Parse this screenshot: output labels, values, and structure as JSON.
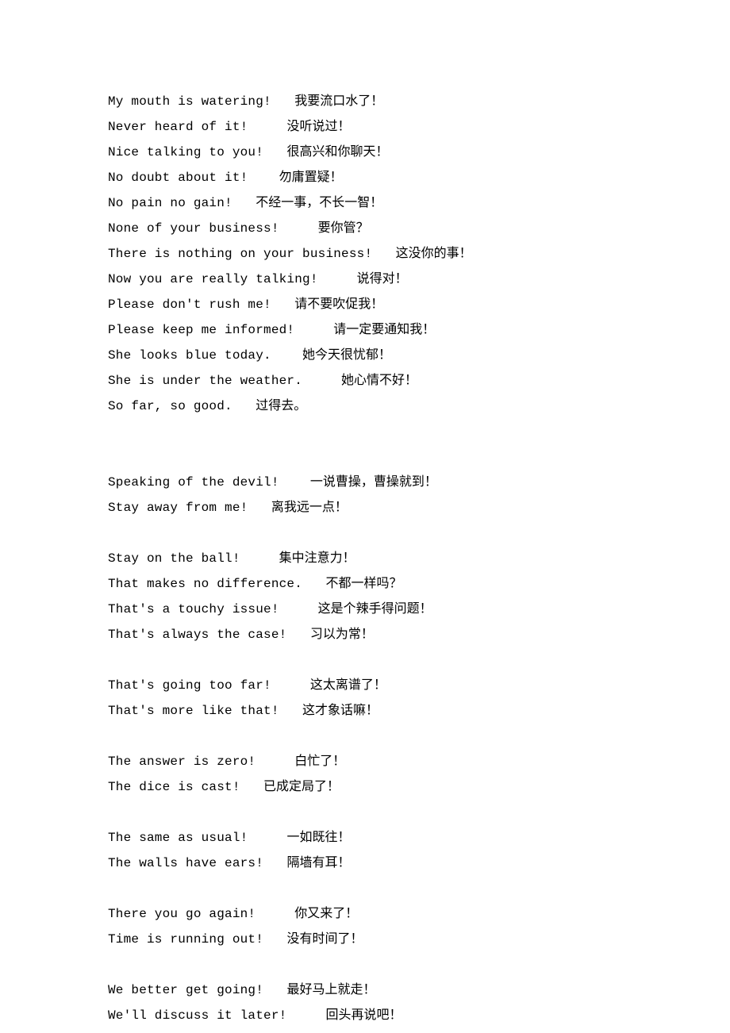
{
  "lines": [
    {
      "en": "My mouth is watering!   ",
      "zh": "我要流口水了！"
    },
    {
      "en": "Never heard of it!     ",
      "zh": "没听说过！"
    },
    {
      "en": "Nice talking to you!   ",
      "zh": "很高兴和你聊天！"
    },
    {
      "en": "No doubt about it!    ",
      "zh": "勿庸置疑！"
    },
    {
      "en": "No pain no gain!   ",
      "zh": "不经一事，不长一智！"
    },
    {
      "en": "None of your business!     ",
      "zh": "要你管？"
    },
    {
      "en": "There is nothing on your business!   ",
      "zh": "这没你的事！"
    },
    {
      "en": "Now you are really talking!     ",
      "zh": "说得对！"
    },
    {
      "en": "Please don't rush me!   ",
      "zh": "请不要吹促我！"
    },
    {
      "en": "Please keep me informed!     ",
      "zh": "请一定要通知我！"
    },
    {
      "en": "She looks blue today.    ",
      "zh": "她今天很忧郁！"
    },
    {
      "en": "She is under the weather.     ",
      "zh": "她心情不好！"
    },
    {
      "en": "So far, so good.   ",
      "zh": "过得去。"
    },
    null,
    null,
    {
      "en": "Speaking of the devil!    ",
      "zh": "一说曹操，曹操就到！"
    },
    {
      "en": "Stay away from me!   ",
      "zh": "离我远一点！"
    },
    null,
    {
      "en": "Stay on the ball!     ",
      "zh": "集中注意力！"
    },
    {
      "en": "That makes no difference.   ",
      "zh": "不都一样吗？"
    },
    {
      "en": "That's a touchy issue!     ",
      "zh": "这是个辣手得问题！"
    },
    {
      "en": "That's always the case!   ",
      "zh": "习以为常！"
    },
    null,
    {
      "en": "That's going too far!     ",
      "zh": "这太离谱了！"
    },
    {
      "en": "That's more like that!   ",
      "zh": "这才象话嘛！"
    },
    null,
    {
      "en": "The answer is zero!     ",
      "zh": "白忙了！"
    },
    {
      "en": "The dice is cast!   ",
      "zh": "已成定局了！"
    },
    null,
    {
      "en": "The same as usual!     ",
      "zh": "一如既往！"
    },
    {
      "en": "The walls have ears!   ",
      "zh": "隔墙有耳！"
    },
    null,
    {
      "en": "There you go again!     ",
      "zh": "你又来了！"
    },
    {
      "en": "Time is running out!   ",
      "zh": "没有时间了！"
    },
    null,
    {
      "en": "We better get going!   ",
      "zh": "最好马上就走！"
    },
    {
      "en": "We'll discuss it later!     ",
      "zh": "回头再说吧！"
    }
  ]
}
